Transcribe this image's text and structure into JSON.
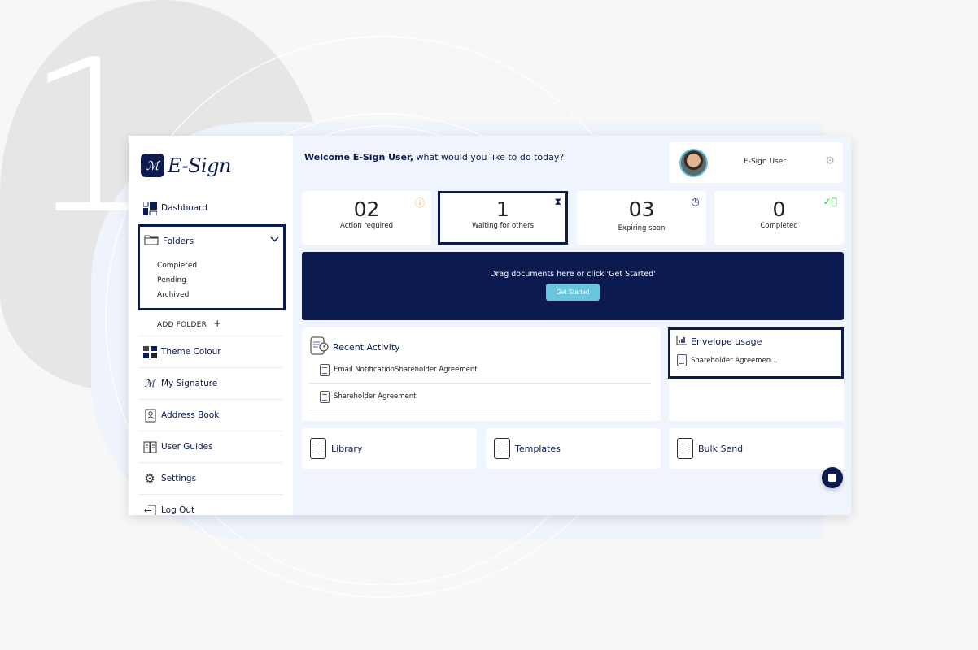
{
  "step_number": "1",
  "brand": {
    "name": "E-Sign"
  },
  "sidebar": {
    "dashboard": "Dashboard",
    "folders": {
      "label": "Folders",
      "items": [
        "Completed",
        "Pending",
        "Archived"
      ]
    },
    "add_folder": "ADD FOLDER",
    "add_folder_icon": "+",
    "items": [
      {
        "label": "Theme Colour",
        "icon": "theme-icon"
      },
      {
        "label": "My Signature",
        "icon": "signature-icon"
      },
      {
        "label": "Address Book",
        "icon": "address-book-icon"
      },
      {
        "label": "User Guides",
        "icon": "book-icon"
      },
      {
        "label": "Settings",
        "icon": "gear-icon"
      },
      {
        "label": "Log Out",
        "icon": "logout-icon"
      }
    ]
  },
  "header": {
    "welcome_bold": "Welcome E-Sign User,",
    "welcome_rest": " what would you like to do today?",
    "user_name": "E-Sign User"
  },
  "stats": [
    {
      "value": "02",
      "label": "Action required",
      "icon": "alert-icon",
      "color": "#f0a020"
    },
    {
      "value": "1",
      "label": "Waiting for others",
      "icon": "hourglass-icon",
      "color": "#0b1a4f"
    },
    {
      "value": "03",
      "label": "Expiring soon",
      "icon": "clock-icon",
      "color": "#0b1a4f"
    },
    {
      "value": "0",
      "label": "Completed",
      "icon": "check-icon",
      "color": "#2ecc40"
    }
  ],
  "dropzone": {
    "text": "Drag documents here or click 'Get Started'",
    "button": "Get Started"
  },
  "recent_activity": {
    "title": "Recent Activity",
    "items": [
      "Email NotificationShareholder Agreement",
      "Shareholder Agreement"
    ]
  },
  "envelope_usage": {
    "title": "Envelope usage",
    "items": [
      "Shareholder Agreemen..."
    ]
  },
  "quick_links": [
    "Library",
    "Templates",
    "Bulk Send"
  ],
  "colors": {
    "brand": "#0b1a4f",
    "accent": "#68c5de",
    "background": "#f0f5fd"
  }
}
